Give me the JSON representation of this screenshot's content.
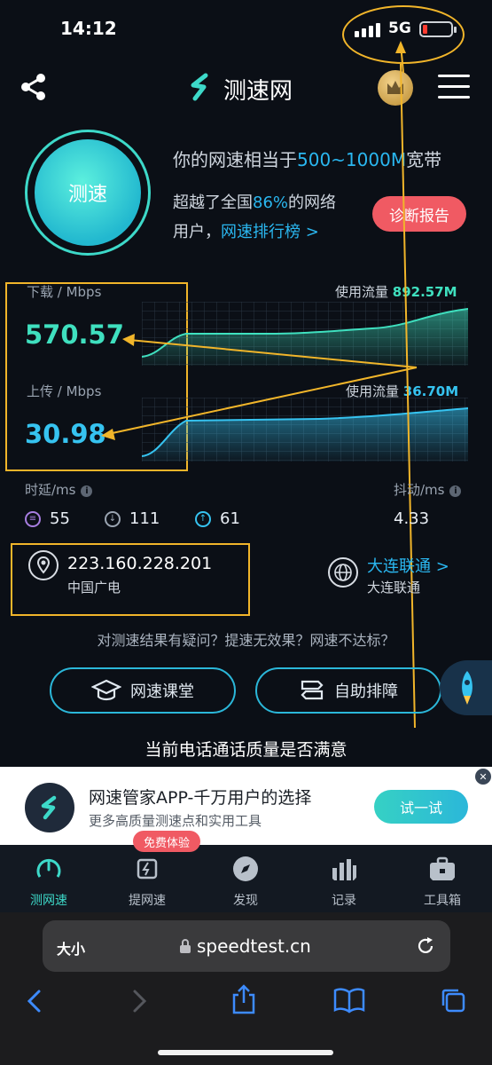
{
  "status_bar": {
    "time": "14:12",
    "network": "5G"
  },
  "header": {
    "app_name": "测速网"
  },
  "speed_button": {
    "label": "测速"
  },
  "summary": {
    "line_prefix": "你的网速相当于",
    "bandwidth": "500~1000M",
    "line_suffix": "宽带",
    "beat_prefix": "超越了全国",
    "beat_percent": "86%",
    "beat_suffix": "的网络",
    "users": "用户，",
    "ranking_link": "网速排行榜 >",
    "report_button": "诊断报告"
  },
  "download": {
    "label": "下载 / Mbps",
    "value": "570.57",
    "usage_label": "使用流量",
    "usage_value": "892.57M"
  },
  "upload": {
    "label": "上传 / Mbps",
    "value": "30.98",
    "usage_label": "使用流量",
    "usage_value": "36.70M"
  },
  "latency": {
    "label": "时延/ms",
    "values": [
      "55",
      "111",
      "61"
    ]
  },
  "jitter": {
    "label": "抖动/ms",
    "value": "4.33"
  },
  "ip": {
    "address": "223.160.228.201",
    "isp": "中国广电"
  },
  "server": {
    "name_link": "大连联通 >",
    "name": "大连联通"
  },
  "question": "对测速结果有疑问？提速无效果？网速不达标？",
  "actions": {
    "classroom": "网速课堂",
    "troubleshoot": "自助排障"
  },
  "survey": "当前电话通话质量是否满意",
  "ad": {
    "title": "网速管家APP-千万用户的选择",
    "subtitle": "更多高质量测速点和实用工具",
    "button": "试一试"
  },
  "tabs": [
    {
      "label": "测网速",
      "active": true
    },
    {
      "label": "提网速",
      "badge": "免费体验"
    },
    {
      "label": "发现"
    },
    {
      "label": "记录"
    },
    {
      "label": "工具箱"
    }
  ],
  "browser": {
    "text_size": "大小",
    "url": "speedtest.cn"
  },
  "colors": {
    "accent_green": "#3fe0bf",
    "accent_blue": "#36c3f0",
    "badge_red": "#f05a63",
    "annotation": "#f1b52a"
  }
}
